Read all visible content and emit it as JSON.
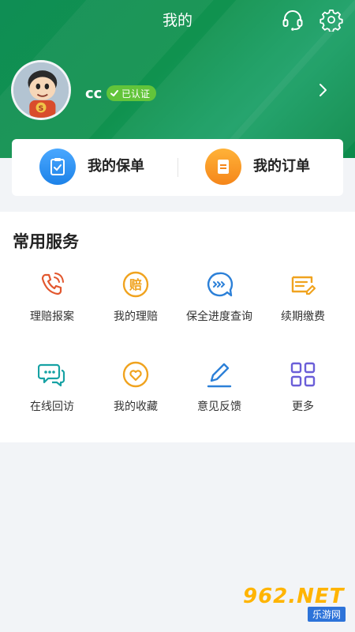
{
  "header": {
    "title": "我的",
    "icons": [
      "customer-service-headset-icon",
      "gear-icon"
    ]
  },
  "profile": {
    "username": "cc",
    "badge": "已认证",
    "avatar": "cartoon-boy-avatar"
  },
  "policy_card": {
    "items": [
      {
        "label": "我的保单",
        "icon": "clipboard-check-icon",
        "color": "#2f94f0"
      },
      {
        "label": "我的订单",
        "icon": "document-list-icon",
        "color": "#f79a1e"
      }
    ]
  },
  "services": {
    "title": "常用服务",
    "items": [
      {
        "label": "理赔报案",
        "icon": "phone-call-icon",
        "color": "#e2572e"
      },
      {
        "label": "我的理赔",
        "icon": "claim-coin-icon",
        "color": "#f0a31f"
      },
      {
        "label": "保全进度查询",
        "icon": "progress-chat-icon",
        "color": "#2c80d8"
      },
      {
        "label": "续期缴费",
        "icon": "renewal-payment-icon",
        "color": "#f0a31f"
      },
      {
        "label": "在线回访",
        "icon": "online-chat-icon",
        "color": "#17a2a4"
      },
      {
        "label": "我的收藏",
        "icon": "heart-favorite-icon",
        "color": "#f0a31f"
      },
      {
        "label": "意见反馈",
        "icon": "edit-pen-icon",
        "color": "#2c80d8"
      },
      {
        "label": "更多",
        "icon": "grid-more-icon",
        "color": "#6a5ed8"
      }
    ]
  },
  "watermark": {
    "main": "962.NET",
    "sub": "乐游网"
  },
  "colors": {
    "header_green": "#0f8e54",
    "badge_green": "#62c43a",
    "background": "#f2f4f7"
  }
}
